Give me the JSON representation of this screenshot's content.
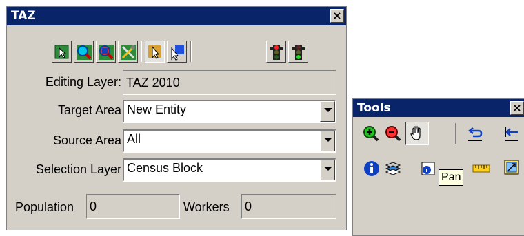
{
  "taz_panel": {
    "title": "TAZ",
    "close_glyph": "×",
    "toolbar": [
      {
        "name": "select-feature-icon"
      },
      {
        "name": "zoom-search-icon"
      },
      {
        "name": "zoom-color-icon"
      },
      {
        "name": "tools-icon"
      },
      {
        "name": "pointer-edit-icon",
        "pressed": true
      },
      {
        "name": "pointer-select-icon"
      },
      {
        "name": "traffic-light-red-icon"
      },
      {
        "name": "traffic-light-green-icon"
      }
    ],
    "editing_layer": {
      "label": "Editing Layer:",
      "value": "TAZ 2010"
    },
    "target_area": {
      "label": "Target Area",
      "value": "New Entity"
    },
    "source_area": {
      "label": "Source Area",
      "value": "All"
    },
    "selection_layer": {
      "label": "Selection Layer",
      "value": "Census Block"
    },
    "population": {
      "label": "Population",
      "value": "0"
    },
    "workers": {
      "label": "Workers",
      "value": "0"
    }
  },
  "tools_panel": {
    "title": "Tools",
    "close_glyph": "×",
    "row1": [
      "zoom-in-icon",
      "zoom-out-icon",
      "pan-hand-icon",
      "undo-icon",
      "previous-extent-icon"
    ],
    "row2": [
      "info-icon",
      "layers-icon",
      "identify-icon",
      "ruler-icon",
      "zoom-extent-icon"
    ],
    "tooltip": "Pan"
  },
  "colors": {
    "titlebar": "#0a246a",
    "face": "#d4d0c8"
  }
}
